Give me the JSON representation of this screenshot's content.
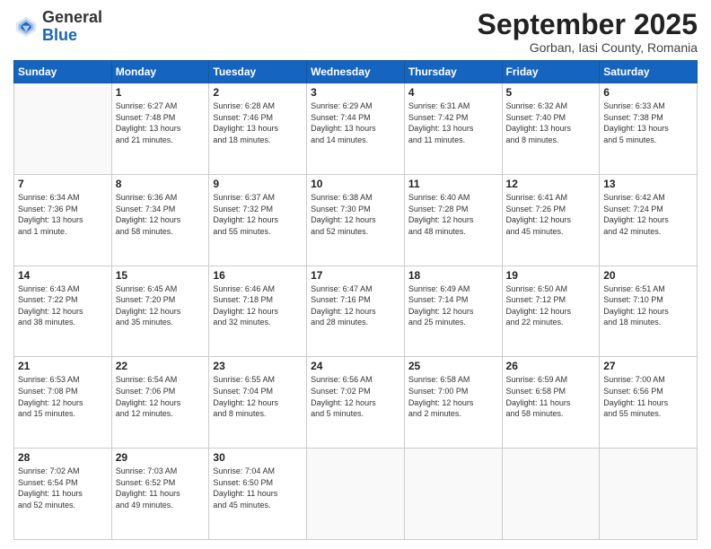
{
  "header": {
    "logo_general": "General",
    "logo_blue": "Blue",
    "month_title": "September 2025",
    "location": "Gorban, Iasi County, Romania"
  },
  "days_of_week": [
    "Sunday",
    "Monday",
    "Tuesday",
    "Wednesday",
    "Thursday",
    "Friday",
    "Saturday"
  ],
  "weeks": [
    [
      {
        "day": "",
        "content": ""
      },
      {
        "day": "1",
        "content": "Sunrise: 6:27 AM\nSunset: 7:48 PM\nDaylight: 13 hours\nand 21 minutes."
      },
      {
        "day": "2",
        "content": "Sunrise: 6:28 AM\nSunset: 7:46 PM\nDaylight: 13 hours\nand 18 minutes."
      },
      {
        "day": "3",
        "content": "Sunrise: 6:29 AM\nSunset: 7:44 PM\nDaylight: 13 hours\nand 14 minutes."
      },
      {
        "day": "4",
        "content": "Sunrise: 6:31 AM\nSunset: 7:42 PM\nDaylight: 13 hours\nand 11 minutes."
      },
      {
        "day": "5",
        "content": "Sunrise: 6:32 AM\nSunset: 7:40 PM\nDaylight: 13 hours\nand 8 minutes."
      },
      {
        "day": "6",
        "content": "Sunrise: 6:33 AM\nSunset: 7:38 PM\nDaylight: 13 hours\nand 5 minutes."
      }
    ],
    [
      {
        "day": "7",
        "content": "Sunrise: 6:34 AM\nSunset: 7:36 PM\nDaylight: 13 hours\nand 1 minute."
      },
      {
        "day": "8",
        "content": "Sunrise: 6:36 AM\nSunset: 7:34 PM\nDaylight: 12 hours\nand 58 minutes."
      },
      {
        "day": "9",
        "content": "Sunrise: 6:37 AM\nSunset: 7:32 PM\nDaylight: 12 hours\nand 55 minutes."
      },
      {
        "day": "10",
        "content": "Sunrise: 6:38 AM\nSunset: 7:30 PM\nDaylight: 12 hours\nand 52 minutes."
      },
      {
        "day": "11",
        "content": "Sunrise: 6:40 AM\nSunset: 7:28 PM\nDaylight: 12 hours\nand 48 minutes."
      },
      {
        "day": "12",
        "content": "Sunrise: 6:41 AM\nSunset: 7:26 PM\nDaylight: 12 hours\nand 45 minutes."
      },
      {
        "day": "13",
        "content": "Sunrise: 6:42 AM\nSunset: 7:24 PM\nDaylight: 12 hours\nand 42 minutes."
      }
    ],
    [
      {
        "day": "14",
        "content": "Sunrise: 6:43 AM\nSunset: 7:22 PM\nDaylight: 12 hours\nand 38 minutes."
      },
      {
        "day": "15",
        "content": "Sunrise: 6:45 AM\nSunset: 7:20 PM\nDaylight: 12 hours\nand 35 minutes."
      },
      {
        "day": "16",
        "content": "Sunrise: 6:46 AM\nSunset: 7:18 PM\nDaylight: 12 hours\nand 32 minutes."
      },
      {
        "day": "17",
        "content": "Sunrise: 6:47 AM\nSunset: 7:16 PM\nDaylight: 12 hours\nand 28 minutes."
      },
      {
        "day": "18",
        "content": "Sunrise: 6:49 AM\nSunset: 7:14 PM\nDaylight: 12 hours\nand 25 minutes."
      },
      {
        "day": "19",
        "content": "Sunrise: 6:50 AM\nSunset: 7:12 PM\nDaylight: 12 hours\nand 22 minutes."
      },
      {
        "day": "20",
        "content": "Sunrise: 6:51 AM\nSunset: 7:10 PM\nDaylight: 12 hours\nand 18 minutes."
      }
    ],
    [
      {
        "day": "21",
        "content": "Sunrise: 6:53 AM\nSunset: 7:08 PM\nDaylight: 12 hours\nand 15 minutes."
      },
      {
        "day": "22",
        "content": "Sunrise: 6:54 AM\nSunset: 7:06 PM\nDaylight: 12 hours\nand 12 minutes."
      },
      {
        "day": "23",
        "content": "Sunrise: 6:55 AM\nSunset: 7:04 PM\nDaylight: 12 hours\nand 8 minutes."
      },
      {
        "day": "24",
        "content": "Sunrise: 6:56 AM\nSunset: 7:02 PM\nDaylight: 12 hours\nand 5 minutes."
      },
      {
        "day": "25",
        "content": "Sunrise: 6:58 AM\nSunset: 7:00 PM\nDaylight: 12 hours\nand 2 minutes."
      },
      {
        "day": "26",
        "content": "Sunrise: 6:59 AM\nSunset: 6:58 PM\nDaylight: 11 hours\nand 58 minutes."
      },
      {
        "day": "27",
        "content": "Sunrise: 7:00 AM\nSunset: 6:56 PM\nDaylight: 11 hours\nand 55 minutes."
      }
    ],
    [
      {
        "day": "28",
        "content": "Sunrise: 7:02 AM\nSunset: 6:54 PM\nDaylight: 11 hours\nand 52 minutes."
      },
      {
        "day": "29",
        "content": "Sunrise: 7:03 AM\nSunset: 6:52 PM\nDaylight: 11 hours\nand 49 minutes."
      },
      {
        "day": "30",
        "content": "Sunrise: 7:04 AM\nSunset: 6:50 PM\nDaylight: 11 hours\nand 45 minutes."
      },
      {
        "day": "",
        "content": ""
      },
      {
        "day": "",
        "content": ""
      },
      {
        "day": "",
        "content": ""
      },
      {
        "day": "",
        "content": ""
      }
    ]
  ]
}
